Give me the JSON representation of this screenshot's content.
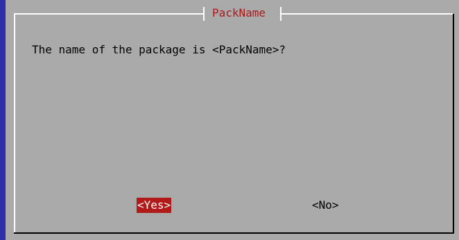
{
  "dialog": {
    "title": "PackName",
    "message": "The name of the package is <PackName>?",
    "buttons": {
      "yes": "<Yes>",
      "no": "<No>"
    }
  },
  "colors": {
    "background": "#2f2fa8",
    "dialog": "#aaaaaa",
    "title": "#b01818",
    "selected_button": "#b21a1a"
  }
}
